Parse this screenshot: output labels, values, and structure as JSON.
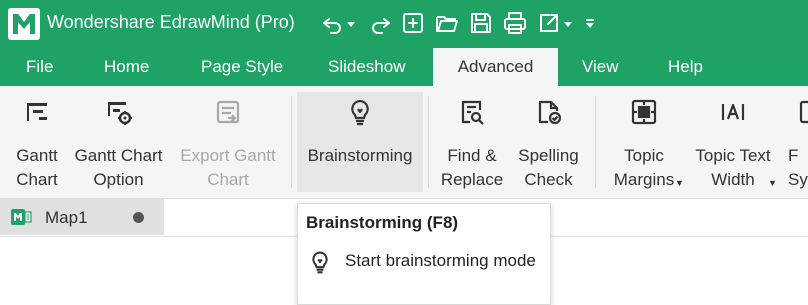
{
  "app": {
    "title": "Wondershare EdrawMind (Pro)"
  },
  "colors": {
    "brand": "#1fa266",
    "ribbon_bg": "#f5f5f5",
    "tab_active_bg": "#f5f5f5",
    "disabled_text": "#a8a8a8"
  },
  "quick_access": {
    "icons": [
      "undo-icon",
      "undo-dropdown-icon",
      "redo-icon",
      "new-file-icon",
      "open-folder-icon",
      "save-icon",
      "print-icon",
      "export-icon",
      "export-dropdown-icon",
      "customize-toolbar-icon"
    ]
  },
  "menu": {
    "tabs": [
      {
        "label": "File"
      },
      {
        "label": "Home"
      },
      {
        "label": "Page Style"
      },
      {
        "label": "Slideshow"
      },
      {
        "label": "Advanced",
        "active": true
      },
      {
        "label": "View"
      },
      {
        "label": "Help"
      }
    ]
  },
  "ribbon": {
    "buttons": [
      {
        "label": "Gantt\nChart",
        "icon": "gantt-chart-icon"
      },
      {
        "label": "Gantt Chart\nOption",
        "icon": "gantt-chart-option-icon"
      },
      {
        "label": "Export Gantt\nChart",
        "icon": "export-gantt-chart-icon",
        "disabled": true
      },
      {
        "label": "Brainstorming",
        "icon": "lightbulb-icon",
        "hovered": true
      },
      {
        "label": "Find &\nReplace",
        "icon": "find-replace-icon"
      },
      {
        "label": "Spelling\nCheck",
        "icon": "spelling-check-icon"
      },
      {
        "label": "Topic\nMargins",
        "icon": "topic-margins-icon",
        "dropdown": true
      },
      {
        "label": "Topic Text\nWidth",
        "icon": "topic-text-width-icon",
        "dropdown": true
      },
      {
        "label": "F\nSy",
        "icon": "partial-icon"
      }
    ]
  },
  "documents": {
    "tabs": [
      {
        "name": "Map1",
        "icon": "mindmap-file-icon",
        "modified": true
      }
    ]
  },
  "tooltip": {
    "title": "Brainstorming (F8)",
    "icon": "lightbulb-icon",
    "text": "Start brainstorming mode"
  }
}
